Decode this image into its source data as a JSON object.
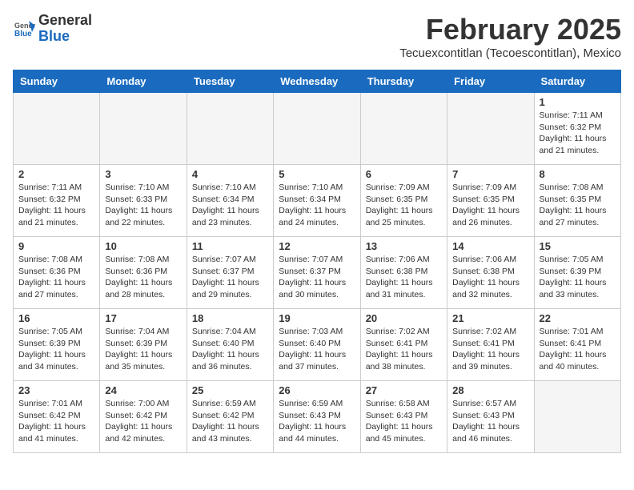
{
  "header": {
    "logo_general": "General",
    "logo_blue": "Blue",
    "month_title": "February 2025",
    "location": "Tecuexcontitlan (Tecoescontitlan), Mexico"
  },
  "days_of_week": [
    "Sunday",
    "Monday",
    "Tuesday",
    "Wednesday",
    "Thursday",
    "Friday",
    "Saturday"
  ],
  "weeks": [
    [
      {
        "day": "",
        "empty": true
      },
      {
        "day": "",
        "empty": true
      },
      {
        "day": "",
        "empty": true
      },
      {
        "day": "",
        "empty": true
      },
      {
        "day": "",
        "empty": true
      },
      {
        "day": "",
        "empty": true
      },
      {
        "day": "1",
        "sunrise": "7:11 AM",
        "sunset": "6:32 PM",
        "daylight": "11 hours and 21 minutes."
      }
    ],
    [
      {
        "day": "2",
        "sunrise": "7:11 AM",
        "sunset": "6:32 PM",
        "daylight": "11 hours and 21 minutes."
      },
      {
        "day": "3",
        "sunrise": "7:10 AM",
        "sunset": "6:33 PM",
        "daylight": "11 hours and 22 minutes."
      },
      {
        "day": "4",
        "sunrise": "7:10 AM",
        "sunset": "6:34 PM",
        "daylight": "11 hours and 23 minutes."
      },
      {
        "day": "5",
        "sunrise": "7:10 AM",
        "sunset": "6:34 PM",
        "daylight": "11 hours and 24 minutes."
      },
      {
        "day": "6",
        "sunrise": "7:09 AM",
        "sunset": "6:35 PM",
        "daylight": "11 hours and 25 minutes."
      },
      {
        "day": "7",
        "sunrise": "7:09 AM",
        "sunset": "6:35 PM",
        "daylight": "11 hours and 26 minutes."
      },
      {
        "day": "8",
        "sunrise": "7:08 AM",
        "sunset": "6:35 PM",
        "daylight": "11 hours and 27 minutes."
      }
    ],
    [
      {
        "day": "9",
        "sunrise": "7:08 AM",
        "sunset": "6:36 PM",
        "daylight": "11 hours and 27 minutes."
      },
      {
        "day": "10",
        "sunrise": "7:08 AM",
        "sunset": "6:36 PM",
        "daylight": "11 hours and 28 minutes."
      },
      {
        "day": "11",
        "sunrise": "7:07 AM",
        "sunset": "6:37 PM",
        "daylight": "11 hours and 29 minutes."
      },
      {
        "day": "12",
        "sunrise": "7:07 AM",
        "sunset": "6:37 PM",
        "daylight": "11 hours and 30 minutes."
      },
      {
        "day": "13",
        "sunrise": "7:06 AM",
        "sunset": "6:38 PM",
        "daylight": "11 hours and 31 minutes."
      },
      {
        "day": "14",
        "sunrise": "7:06 AM",
        "sunset": "6:38 PM",
        "daylight": "11 hours and 32 minutes."
      },
      {
        "day": "15",
        "sunrise": "7:05 AM",
        "sunset": "6:39 PM",
        "daylight": "11 hours and 33 minutes."
      }
    ],
    [
      {
        "day": "16",
        "sunrise": "7:05 AM",
        "sunset": "6:39 PM",
        "daylight": "11 hours and 34 minutes."
      },
      {
        "day": "17",
        "sunrise": "7:04 AM",
        "sunset": "6:39 PM",
        "daylight": "11 hours and 35 minutes."
      },
      {
        "day": "18",
        "sunrise": "7:04 AM",
        "sunset": "6:40 PM",
        "daylight": "11 hours and 36 minutes."
      },
      {
        "day": "19",
        "sunrise": "7:03 AM",
        "sunset": "6:40 PM",
        "daylight": "11 hours and 37 minutes."
      },
      {
        "day": "20",
        "sunrise": "7:02 AM",
        "sunset": "6:41 PM",
        "daylight": "11 hours and 38 minutes."
      },
      {
        "day": "21",
        "sunrise": "7:02 AM",
        "sunset": "6:41 PM",
        "daylight": "11 hours and 39 minutes."
      },
      {
        "day": "22",
        "sunrise": "7:01 AM",
        "sunset": "6:41 PM",
        "daylight": "11 hours and 40 minutes."
      }
    ],
    [
      {
        "day": "23",
        "sunrise": "7:01 AM",
        "sunset": "6:42 PM",
        "daylight": "11 hours and 41 minutes."
      },
      {
        "day": "24",
        "sunrise": "7:00 AM",
        "sunset": "6:42 PM",
        "daylight": "11 hours and 42 minutes."
      },
      {
        "day": "25",
        "sunrise": "6:59 AM",
        "sunset": "6:42 PM",
        "daylight": "11 hours and 43 minutes."
      },
      {
        "day": "26",
        "sunrise": "6:59 AM",
        "sunset": "6:43 PM",
        "daylight": "11 hours and 44 minutes."
      },
      {
        "day": "27",
        "sunrise": "6:58 AM",
        "sunset": "6:43 PM",
        "daylight": "11 hours and 45 minutes."
      },
      {
        "day": "28",
        "sunrise": "6:57 AM",
        "sunset": "6:43 PM",
        "daylight": "11 hours and 46 minutes."
      },
      {
        "day": "",
        "empty": true
      }
    ]
  ]
}
